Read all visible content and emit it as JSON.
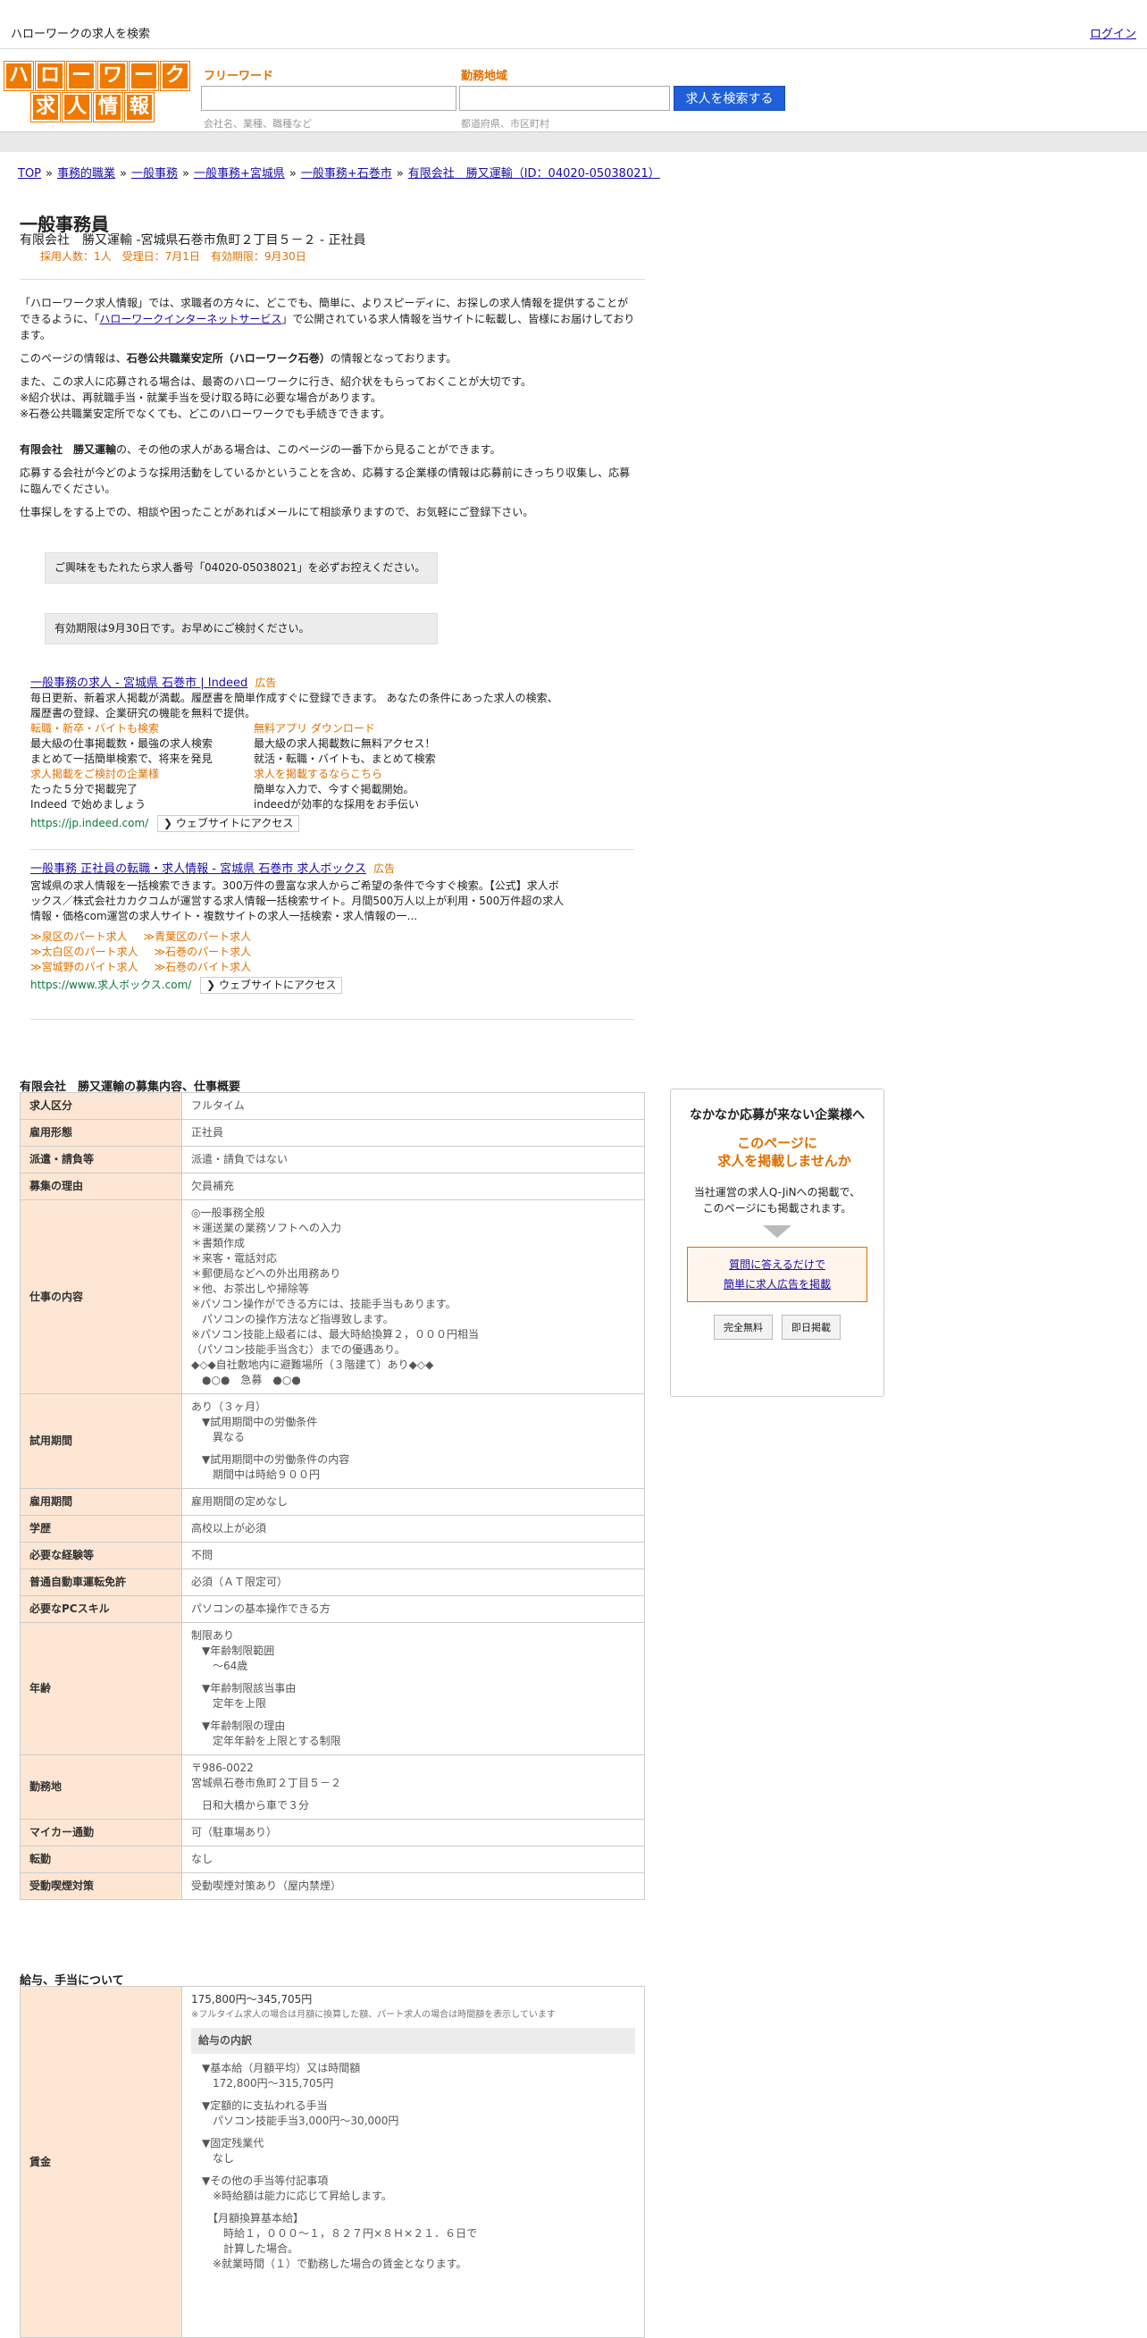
{
  "topbar": {
    "title": "ハローワークの求人を検索",
    "login": "ログイン"
  },
  "logo": {
    "row1": [
      "ハ",
      "ロ",
      "ー",
      "ワ",
      "ー",
      "ク"
    ],
    "row2": [
      "求",
      "人",
      "情",
      "報"
    ]
  },
  "search": {
    "freeword_label": "フリーワード",
    "freeword_placeholder": "会社名、業種、職種など",
    "area_label": "勤務地域",
    "area_placeholder": "都道府県、市区町村",
    "button": "求人を検索する"
  },
  "breadcrumb": [
    "TOP",
    "事務的職業",
    "一般事務",
    "一般事務+宮城県",
    "一般事務+石巻市",
    "有限会社　勝又運輸（ID：04020-05038021）"
  ],
  "job": {
    "title": "一般事務員",
    "company_line": "有限会社　勝又運輸 -宮城県石巻市魚町２丁目５－２ - 正社員",
    "meta": "採用人数：1人　受理日：7月1日　有効期限：9月30日"
  },
  "intro": {
    "p1a": "「ハローワーク求人情報」では、求職者の方々に、どこでも、簡単に、よりスピーディに、お探しの求人情報を提供することができるように、「",
    "p1link": "ハローワークインターネットサービス",
    "p1b": "」で公開されている求人情報を当サイトに転載し、皆様にお届けしております。",
    "p2a": "このページの情報は、",
    "p2b": "石巻公共職業安定所（ハローワーク石巻）",
    "p2c": "の情報となっております。",
    "p3": "また、この求人に応募される場合は、最寄のハローワークに行き、紹介状をもらっておくことが大切です。",
    "p4": "※紹介状は、再就職手当・就業手当を受け取る時に必要な場合があります。",
    "p5": "※石巻公共職業安定所でなくても、どこのハローワークでも手続きできます。",
    "p6a": "有限会社　勝又運輸",
    "p6b": "の、その他の求人がある場合は、このページの一番下から見ることができます。",
    "p7": "応募する会社が今どのような採用活動をしているかということを含め、応募する企業様の情報は応募前にきっちり収集し、応募に臨んでください。",
    "p8": "仕事探しをする上での、相談や困ったことがあればメールにて相談承りますので、お気軽にご登録下さい。"
  },
  "notes": {
    "n1": "ご興味をもたれたら求人番号「04020-05038021」を必ずお控えください。",
    "n2": "有効期限は9月30日です。お早めにご検討ください。"
  },
  "ads": [
    {
      "title": "一般事務の求人 - 宮城県 石巻市 | Indeed",
      "badge": "広告",
      "desc": "毎日更新、新着求人掲載が満載。履歴書を簡単作成すぐに登録できます。 あなたの条件にあった求人の検索、履歴書の登録、企業研究の機能を無料で提供。",
      "links": [
        {
          "h": "転職・新卒・バイトも検索",
          "d1": "最大級の仕事掲載数・最強の求人検索",
          "d2": "まとめて一括簡単検索で、将来を発見"
        },
        {
          "h": "無料アプリ ダウンロード",
          "d1": "最大級の求人掲載数に無料アクセス！",
          "d2": "就活・転職・バイトも、まとめて検索"
        },
        {
          "h": "求人掲載をご検討の企業様",
          "d1": "たった５分で掲載完了",
          "d2": "Indeed で始めましょう"
        },
        {
          "h": "求人を掲載するならこちら",
          "d1": "簡単な入力で、今すぐ掲載開始。",
          "d2": "indeedが効率的な採用をお手伝い"
        }
      ],
      "url": "https://jp.indeed.com/",
      "visit": "❯ ウェブサイトにアクセス"
    },
    {
      "title": "一般事務 正社員の転職・求人情報 - 宮城県 石巻市 求人ボックス",
      "badge": "広告",
      "desc": "宮城県の求人情報を一括検索できます。300万件の豊富な求人からご希望の条件で今すぐ検索。【公式】求人ボックス／株式会社カカクコムが運営する求人情報一括検索サイト。月間500万人以上が利用・500万件超の求人情報・価格com運営の求人サイト・複数サイトの求人一括検索・求人情報の一...",
      "sitelinks": [
        [
          "≫泉区のパート求人",
          "≫青葉区のパート求人"
        ],
        [
          "≫太白区のパート求人",
          "≫石巻のパート求人"
        ],
        [
          "≫宮城野のバイト求人",
          "≫石巻のバイト求人"
        ]
      ],
      "url": "https://www.求人ボックス.com/",
      "visit": "❯ ウェブサイトにアクセス"
    }
  ],
  "details_title": "有限会社　勝又運輸の募集内容、仕事概要",
  "details": [
    {
      "k": "求人区分",
      "v": "フルタイム"
    },
    {
      "k": "雇用形態",
      "v": "正社員"
    },
    {
      "k": "派遣・請負等",
      "v": "派遣・請負ではない"
    },
    {
      "k": "募集の理由",
      "v": "欠員補充"
    },
    {
      "k": "仕事の内容",
      "lines": [
        "◎一般事務全般",
        "＊運送業の業務ソフトへの入力",
        "＊書類作成",
        "＊来客・電話対応",
        "＊郵便局などへの外出用務あり",
        "＊他、お茶出しや掃除等",
        "※パソコン操作ができる方には、技能手当もあります。",
        "　パソコンの操作方法など指導致します。",
        "※パソコン技能上級者には、最大時給換算２，０００円相当",
        "（パソコン技能手当含む）までの優遇あり。",
        "◆◇◆自社敷地内に避難場所（３階建て）あり◆◇◆",
        "　●○●　急募　●○●"
      ]
    },
    {
      "k": "試用期間",
      "lines": [
        "あり（３ヶ月）",
        "　▼試用期間中の労働条件",
        "　　異なる",
        "",
        "　▼試用期間中の労働条件の内容",
        "　　期間中は時給９００円"
      ]
    },
    {
      "k": "雇用期間",
      "v": "雇用期間の定めなし"
    },
    {
      "k": "学歴",
      "v": "高校以上が必須"
    },
    {
      "k": "必要な経験等",
      "v": "不問"
    },
    {
      "k": "普通自動車運転免許",
      "v": "必須（ＡＴ限定可）"
    },
    {
      "k": "必要なPCスキル",
      "v": "パソコンの基本操作できる方"
    },
    {
      "k": "年齢",
      "lines": [
        "制限あり",
        "　▼年齢制限範囲",
        "　　〜64歳",
        "",
        "　▼年齢制限該当事由",
        "　　定年を上限",
        "",
        "　▼年齢制限の理由",
        "　　定年年齢を上限とする制限"
      ]
    },
    {
      "k": "勤務地",
      "lines": [
        "〒986-0022",
        "宮城県石巻市魚町２丁目５－２",
        "",
        "　日和大橋から車で３分"
      ]
    },
    {
      "k": "マイカー通勤",
      "v": "可（駐車場あり）"
    },
    {
      "k": "転勤",
      "v": "なし"
    },
    {
      "k": "受動喫煙対策",
      "v": "受動喫煙対策あり（屋内禁煙）"
    }
  ],
  "salary_title": "給与、手当について",
  "salary": {
    "k": "賃金",
    "range": "175,800円〜345,705円",
    "note": "※フルタイム求人の場合は月額に換算した額、パート求人の場合は時間額を表示しています",
    "inner_title": "給与の内訳",
    "lines": [
      "　▼基本給（月額平均）又は時間額",
      "　　172,800円〜315,705円",
      "",
      "　▼定額的に支払われる手当",
      "　　パソコン技能手当3,000円〜30,000円",
      "",
      "　▼固定残業代",
      "　　なし",
      "",
      "　▼その他の手当等付記事項",
      "　　※時給額は能力に応じて昇給します。",
      "",
      "　　【月額換算基本給】",
      "　　　時給１，０００〜１，８２７円×８Ｈ×２１．６日で",
      "　　　計算した場合。",
      "　　※就業時間（１）で勤務した場合の賃金となります。"
    ]
  },
  "sidebar": {
    "heading": "なかなか応募が来ない企業様へ",
    "orange1": "このページに",
    "orange2": "求人を掲載しませんか",
    "text1": "当社運営の求人Q-JiNへの掲載で、",
    "text2": "このページにも掲載されます。",
    "link1": "質問に答えるだけで",
    "link2": "簡単に求人広告を掲載",
    "btn1": "完全無料",
    "btn2": "即日掲載"
  },
  "colors": {
    "accent": "#f07a00",
    "button": "#1f5fd9",
    "table_key_bg": "#fde7d4"
  }
}
